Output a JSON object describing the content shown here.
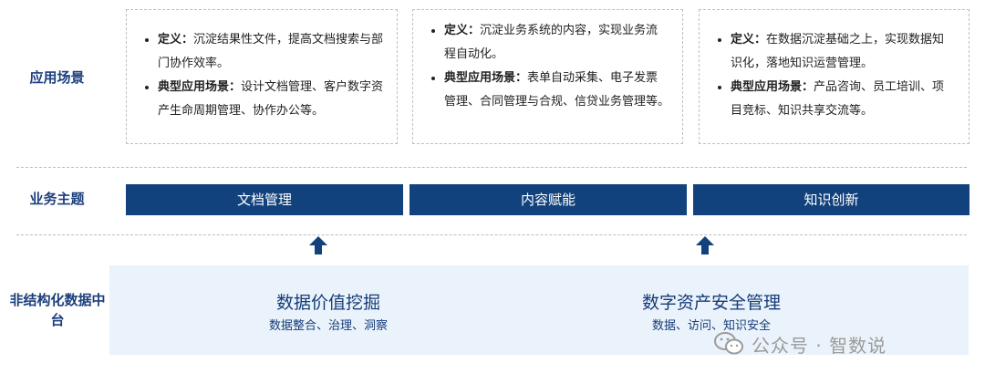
{
  "rows": {
    "scenarios": "应用场景",
    "topics": "业务主题",
    "platform": "非结构化数据中台"
  },
  "cards": [
    {
      "def_label": "定义：",
      "def_text": "沉淀结果性文件，提高文档搜索与部门协作效率。",
      "case_label": "典型应用场景：",
      "case_text": "设计文档管理、客户数字资产生命周期管理、协作办公等。"
    },
    {
      "def_label": "定义：",
      "def_text": "沉淀业务系统的内容，实现业务流程自动化。",
      "case_label": "典型应用场景：",
      "case_text": "表单自动采集、电子发票管理、合同管理与合规、信贷业务管理等。"
    },
    {
      "def_label": "定义：",
      "def_text": "在数据沉淀基础之上，实现数据知识化，落地知识运营管理。",
      "case_label": "典型应用场景：",
      "case_text": "产品咨询、员工培训、项目竞标、知识共享交流等。"
    }
  ],
  "topics": [
    "文档管理",
    "内容赋能",
    "知识创新"
  ],
  "platform_items": [
    {
      "name": "数据价值挖掘",
      "desc": "数据整合、治理、洞察"
    },
    {
      "name": "数字资产安全管理",
      "desc": "数据、访问、知识安全"
    }
  ],
  "watermark": "公众号 · 智数说",
  "colors": {
    "navy": "#12427d",
    "label": "#1c3f7d",
    "platform_bg": "#eaf3fb",
    "dash": "#bdbdbd"
  }
}
